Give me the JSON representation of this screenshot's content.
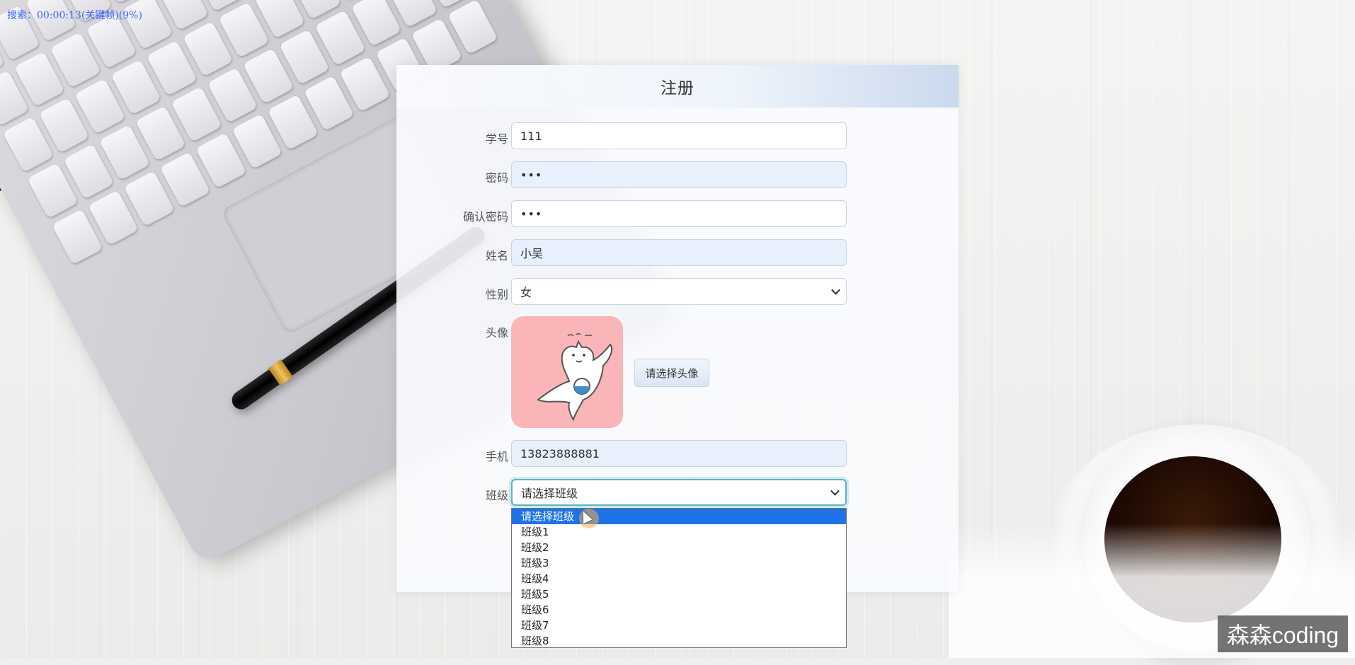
{
  "overlay": {
    "search_status": "搜索：00:00:13(关键帧)(9%)",
    "watermark": "森森coding"
  },
  "form": {
    "title": "注册",
    "fields": {
      "student_id": {
        "label": "学号",
        "value": "111"
      },
      "password": {
        "label": "密码",
        "value": "•••"
      },
      "confirm_password": {
        "label": "确认密码",
        "value": "•••"
      },
      "name": {
        "label": "姓名",
        "value": "小吴"
      },
      "gender": {
        "label": "性别",
        "value": "女"
      },
      "avatar": {
        "label": "头像",
        "button": "请选择头像"
      },
      "phone": {
        "label": "手机",
        "value": "13823888881"
      },
      "class": {
        "label": "班级",
        "value": "请选择班级"
      }
    },
    "class_options": [
      "请选择班级",
      "班级1",
      "班级2",
      "班级3",
      "班级4",
      "班级5",
      "班级6",
      "班级7",
      "班级8"
    ],
    "selected_option_index": 0
  },
  "colors": {
    "accent": "#1e73e8",
    "focus_border": "#56b4c8",
    "autofill_bg": "#e8f0fe",
    "avatar_bg": "#f9b5b8",
    "status_text": "#3d63ff"
  },
  "icons": [
    "chevron-down-icon",
    "cat-avatar-image",
    "mouse-cursor-icon"
  ]
}
